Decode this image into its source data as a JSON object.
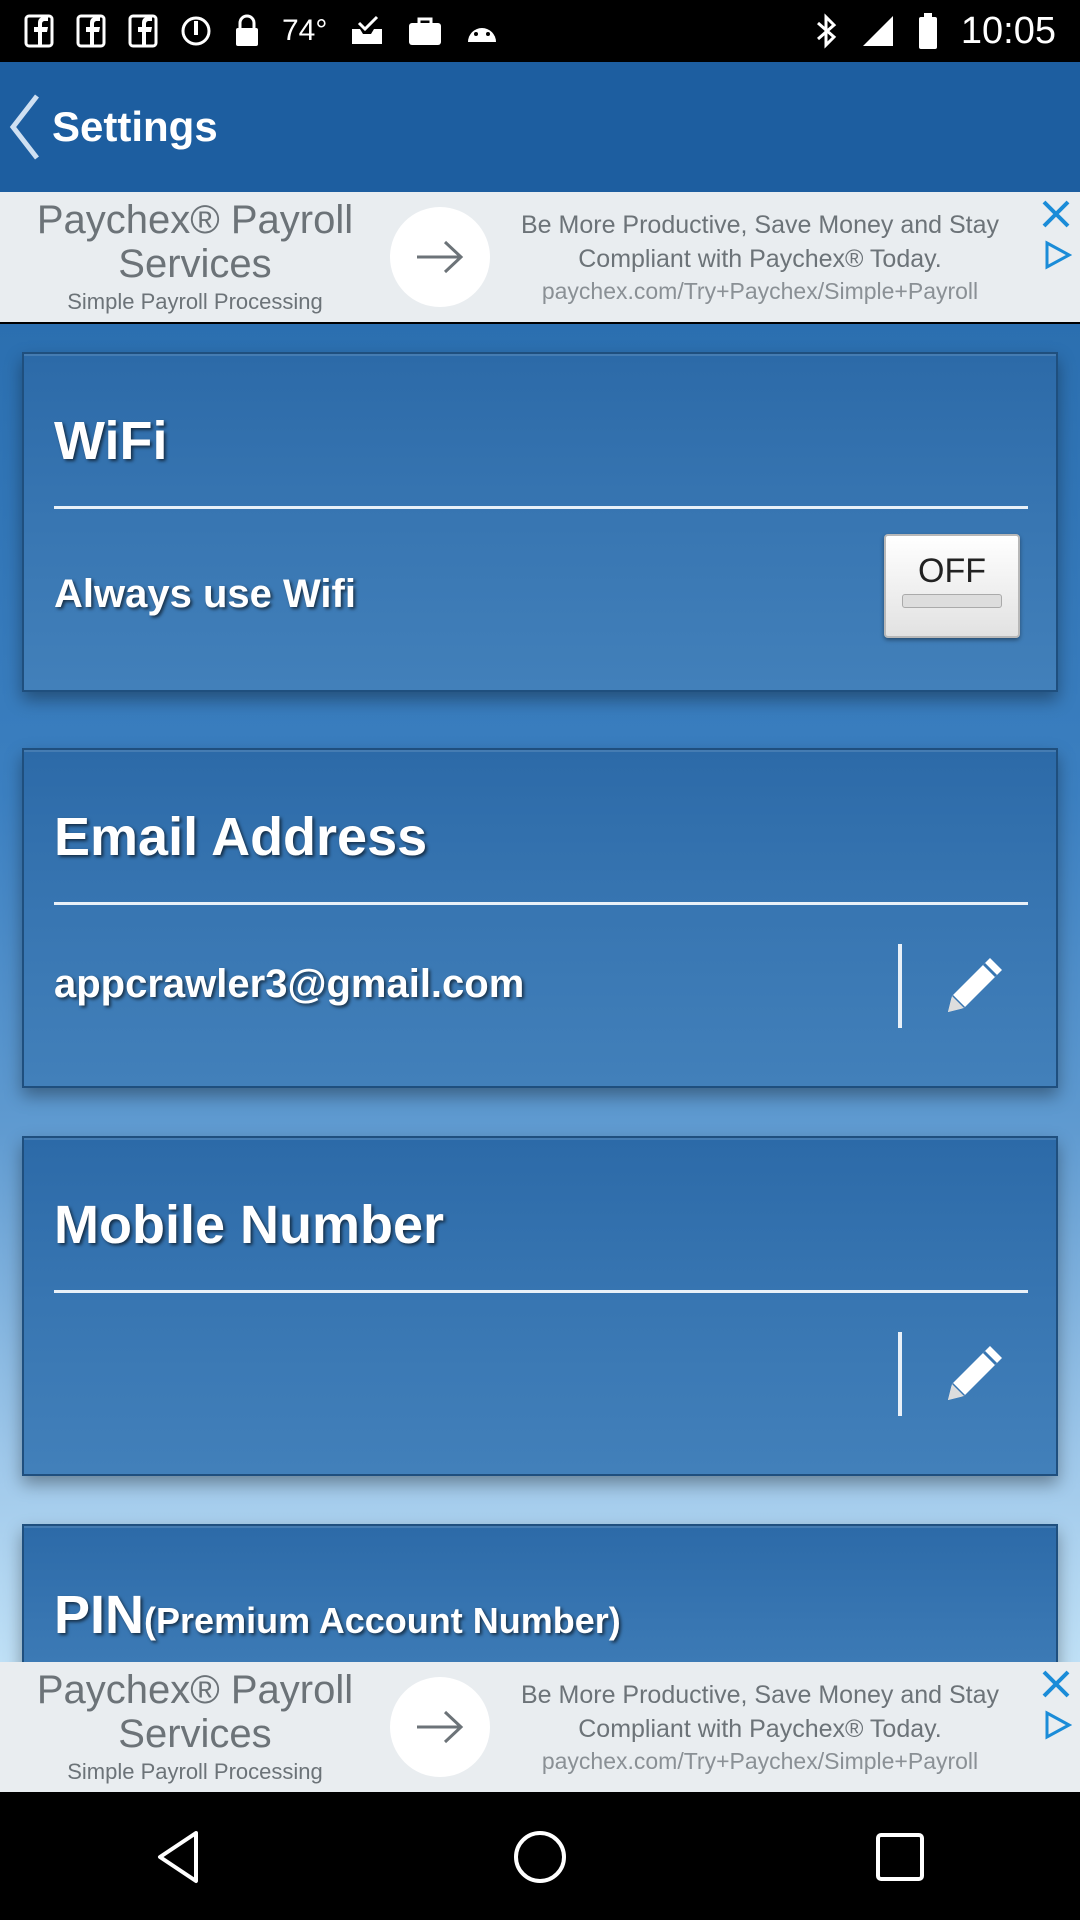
{
  "status_bar": {
    "temperature": "74°",
    "time": "10:05"
  },
  "app_bar": {
    "title": "Settings"
  },
  "ad_banner": {
    "brand_line1": "Paychex® Payroll",
    "brand_line2": "Services",
    "tagline": "Simple Payroll Processing",
    "message_line1": "Be More Productive, Save Money and Stay",
    "message_line2": "Compliant with Paychex® Today.",
    "url": "paychex.com/Try+Paychex/Simple+Payroll"
  },
  "wifi_card": {
    "title": "WiFi",
    "row_label": "Always use Wifi",
    "toggle_state": "OFF"
  },
  "email_card": {
    "title": "Email Address",
    "value": "appcrawler3@gmail.com"
  },
  "mobile_card": {
    "title": "Mobile Number",
    "value": ""
  },
  "pin_card": {
    "title": "PIN",
    "subtitle": "(Premium Account Number)"
  },
  "colors": {
    "app_bar": "#1d5ea0",
    "card": "#3876b2",
    "ad_background": "#e9edf0"
  }
}
